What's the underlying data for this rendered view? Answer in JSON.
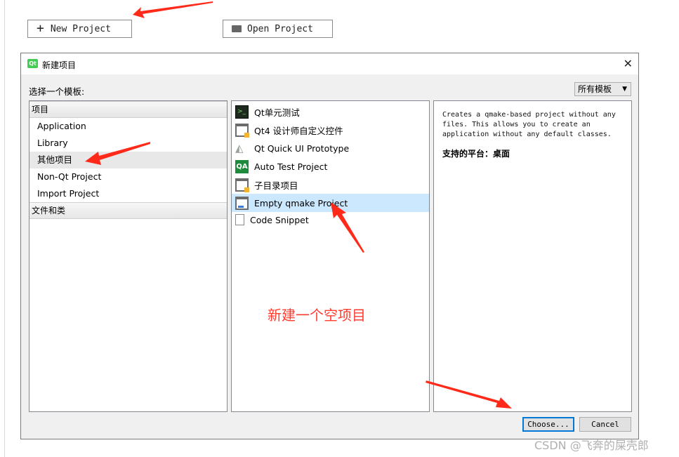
{
  "welcome": {
    "new_project": "New Project",
    "open_project": "Open Project"
  },
  "dialog": {
    "title": "新建项目",
    "choose_template_label": "选择一个模板:",
    "filter_selected": "所有模板",
    "categories": {
      "group_projects": "项目",
      "items": [
        "Application",
        "Library",
        "其他项目",
        "Non-Qt Project",
        "Import Project"
      ],
      "selected": "其他项目",
      "group_files": "文件和类"
    },
    "templates": {
      "items": [
        "Qt单元测试",
        "Qt4 设计师自定义控件",
        "Qt Quick UI Prototype",
        "Auto Test Project",
        "子目录项目",
        "Empty qmake Project",
        "Code Snippet"
      ],
      "icons": [
        "terminal-icon",
        "designer-widget-icon",
        "quick-ui-icon",
        "qa-icon",
        "subdirs-icon",
        "qmake-icon",
        "snippet-icon"
      ],
      "selected": "Empty qmake Project"
    },
    "description": {
      "text": "Creates a qmake-based project without any files. This allows you to create an application without any default classes.",
      "platforms_label": "支持的平台",
      "platforms_value": "：桌面"
    },
    "buttons": {
      "choose": "Choose...",
      "cancel": "Cancel"
    }
  },
  "annotation_text": "新建一个空项目",
  "watermark": "CSDN @飞奔的屎壳郎",
  "colors": {
    "arrow": "#ff2a1a",
    "selection": "#cce8ff",
    "qt_green": "#41cd52",
    "default_button_border": "#0078d7"
  }
}
